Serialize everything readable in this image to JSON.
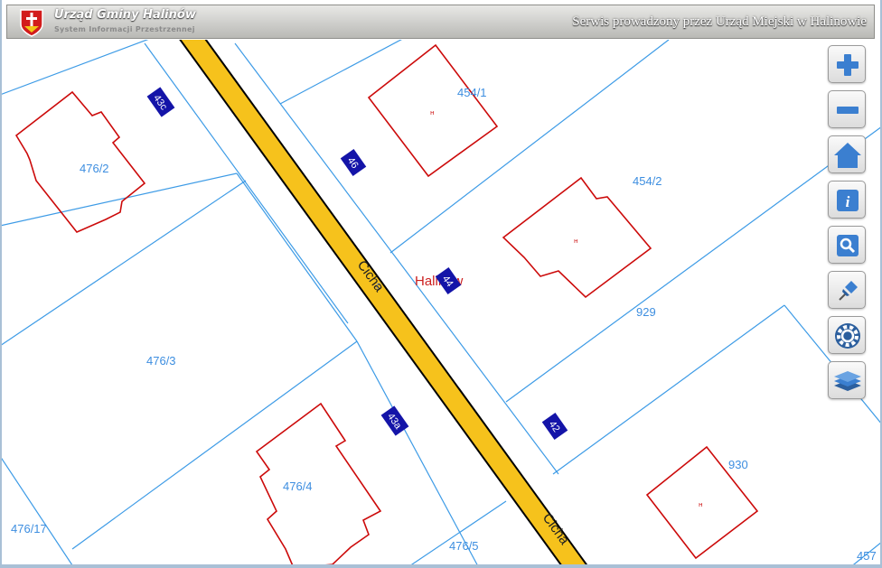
{
  "header": {
    "brand_title": "Urząd Gminy Halinów",
    "brand_subtitle": "System Informacji Przestrzennej",
    "service_text": "Serwis prowadzony przez Urząd Miejski w Halinowie"
  },
  "map": {
    "parcels": [
      "454/1",
      "454/2",
      "476/2",
      "476/3",
      "476/4",
      "476/5",
      "476/17",
      "929",
      "930",
      "457"
    ],
    "street_labels": [
      "Cicha",
      "Cicha"
    ],
    "house_numbers": [
      "43c",
      "46",
      "44",
      "43a",
      "42"
    ],
    "place_label": "Halinów",
    "stray_label": "c",
    "colors": {
      "road": "#f6c21c",
      "parcel_line": "#3d9be6",
      "building": "#cc0a0a",
      "number_badge": "#1414a8",
      "parcel_label": "#3d8ee0"
    }
  },
  "toolbar": {
    "buttons": [
      "zoom-in",
      "zoom-out",
      "home",
      "info",
      "search",
      "pin",
      "settings",
      "layers"
    ]
  }
}
